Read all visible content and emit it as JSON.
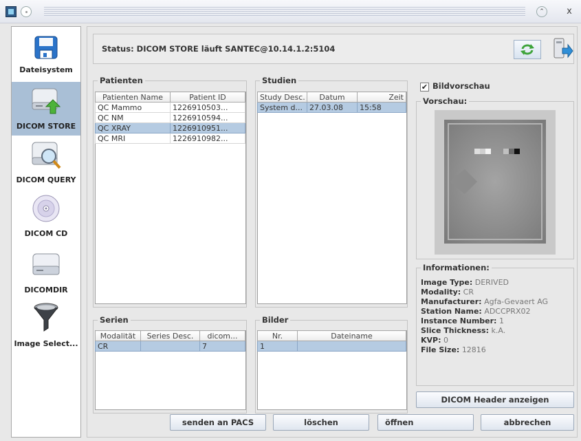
{
  "window": {
    "minimize_glyph": "⌃",
    "close_glyph": "x"
  },
  "sidebar": {
    "items": [
      {
        "label": "Dateisystem",
        "icon": "floppy-disk-icon",
        "selected": false
      },
      {
        "label": "DICOM STORE",
        "icon": "drive-store-icon",
        "selected": true
      },
      {
        "label": "DICOM QUERY",
        "icon": "drive-search-icon",
        "selected": false
      },
      {
        "label": "DICOM CD",
        "icon": "cd-icon",
        "selected": false
      },
      {
        "label": "DICOMDIR",
        "icon": "drive-icon",
        "selected": false
      },
      {
        "label": "Image Select...",
        "icon": "funnel-icon",
        "selected": false
      }
    ]
  },
  "status": {
    "text": "Status:  DICOM STORE läuft  SANTEC@10.14.1.2:5104",
    "refresh_icon": "refresh-icon",
    "export_icon": "export-icon"
  },
  "patienten": {
    "title": "Patienten",
    "columns": [
      "Patienten Name",
      "Patient ID"
    ],
    "rows": [
      [
        "QC Mammo",
        "1226910503..."
      ],
      [
        "QC NM",
        "1226910594..."
      ],
      [
        "QC XRAY",
        "1226910951..."
      ],
      [
        "QC MRI",
        "1226910982..."
      ]
    ],
    "selected_index": 2
  },
  "studien": {
    "title": "Studien",
    "columns": [
      "Study Desc.",
      "Datum",
      "Zeit"
    ],
    "rows": [
      [
        "System d...",
        "27.03.08",
        "15:58"
      ]
    ],
    "selected_index": 0
  },
  "serien": {
    "title": "Serien",
    "columns": [
      "Modalität",
      "Series Desc.",
      "dicom..."
    ],
    "rows": [
      [
        "CR",
        "",
        "7"
      ]
    ],
    "selected_index": 0
  },
  "bilder": {
    "title": "Bilder",
    "columns": [
      "Nr.",
      "Dateiname"
    ],
    "rows": [
      [
        "1",
        ""
      ]
    ],
    "selected_index": 0
  },
  "preview": {
    "checkbox_label": "Bildvorschau",
    "checked": true,
    "group_title": "Vorschau:"
  },
  "info": {
    "title": "Informationen:",
    "lines": [
      {
        "label": "Image Type:",
        "value": "DERIVED"
      },
      {
        "label": "Modality:",
        "value": "CR"
      },
      {
        "label": "Manufacturer:",
        "value": "Agfa-Gevaert AG"
      },
      {
        "label": "Station Name:",
        "value": "ADCCPRX02"
      },
      {
        "label": "Instance Number:",
        "value": "1"
      },
      {
        "label": "Slice Thickness:",
        "value": "k.A."
      },
      {
        "label": "KVP:",
        "value": "0"
      },
      {
        "label": "File Size:",
        "value": "12816"
      }
    ]
  },
  "buttons": {
    "dicom_header": "DICOM Header anzeigen",
    "send_pacs": "senden an PACS",
    "delete": "löschen",
    "open": "öffnen",
    "cancel": "abbrechen"
  }
}
